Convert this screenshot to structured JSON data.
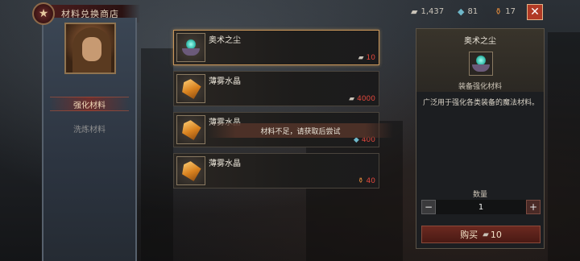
{
  "header": {
    "title": "材料兑换商店",
    "emblem_icon": "star-emblem-icon",
    "currencies": [
      {
        "icon": "platinum-icon",
        "value": "1,437"
      },
      {
        "icon": "gem-icon",
        "value": "81"
      },
      {
        "icon": "potion-icon",
        "value": "17"
      }
    ],
    "close_label": "✕"
  },
  "sidebar": {
    "tabs": [
      {
        "label": "强化材料",
        "active": true
      },
      {
        "label": "洗炼材料",
        "active": false
      }
    ]
  },
  "items": [
    {
      "name": "奥术之尘",
      "price": "10",
      "currency_icon": "platinum-icon",
      "selected": true,
      "icon": "arcane-dust-icon"
    },
    {
      "name": "薄雾水晶",
      "price": "4000",
      "currency_icon": "platinum-icon",
      "selected": false,
      "icon": "misty-crystal-icon"
    },
    {
      "name": "薄雾水晶",
      "price": "400",
      "currency_icon": "gem-icon",
      "selected": false,
      "icon": "misty-crystal-icon"
    },
    {
      "name": "薄雾水晶",
      "price": "40",
      "currency_icon": "potion-icon",
      "selected": false,
      "icon": "misty-crystal-icon"
    }
  ],
  "toast": "材料不足，请获取后尝试",
  "detail": {
    "title": "奥术之尘",
    "category": "装备强化材料",
    "description": "广泛用于强化各类装备的魔法材料。",
    "quantity_label": "数量",
    "quantity": "1",
    "minus": "−",
    "plus": "+",
    "buy_label": "购买",
    "buy_price": "10"
  },
  "colors": {
    "accent_red": "#b13a25",
    "price_red": "#e0473c",
    "selected_border": "#c9965a"
  }
}
